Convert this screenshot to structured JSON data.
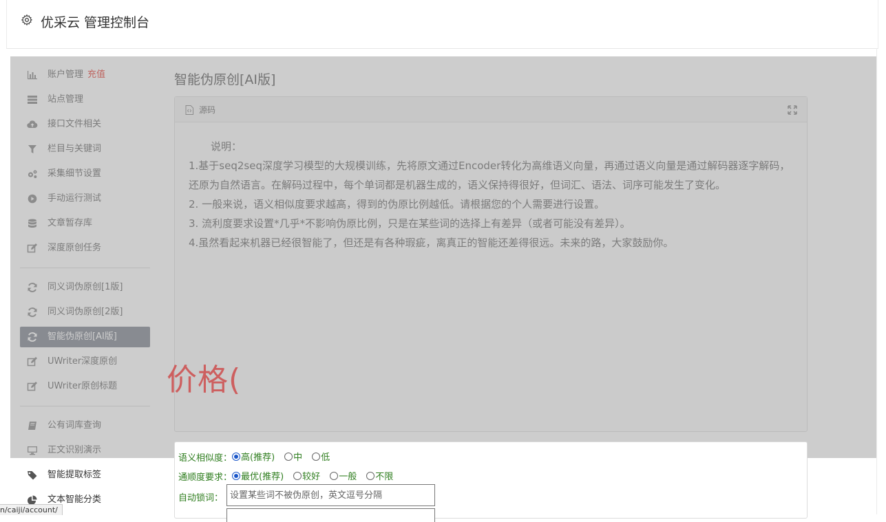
{
  "app": {
    "title": "优采云 管理控制台"
  },
  "sidebar": {
    "items": [
      {
        "label": "账户管理",
        "extra": "充值",
        "icon": "bar-chart-icon"
      },
      {
        "label": "站点管理",
        "icon": "server-icon"
      },
      {
        "label": "接口文件相关",
        "icon": "cloud-upload-icon"
      },
      {
        "label": "栏目与关键词",
        "icon": "filter-icon"
      },
      {
        "label": "采集细节设置",
        "icon": "gears-icon"
      },
      {
        "label": "手动运行测试",
        "icon": "play-circle-icon"
      },
      {
        "label": "文章暂存库",
        "icon": "database-icon"
      },
      {
        "label": "深度原创任务",
        "icon": "edit-icon"
      },
      {
        "label": "同义词伪原创[1版]",
        "icon": "refresh-icon"
      },
      {
        "label": "同义词伪原创[2版]",
        "icon": "refresh-icon"
      },
      {
        "label": "智能伪原创[AI版]",
        "icon": "refresh-icon",
        "active": true
      },
      {
        "label": "UWriter深度原创",
        "icon": "edit-icon"
      },
      {
        "label": "UWriter原创标题",
        "icon": "edit-icon"
      },
      {
        "label": "公有词库查询",
        "icon": "book-icon"
      },
      {
        "label": "正文识别演示",
        "icon": "monitor-icon"
      },
      {
        "label": "智能提取标签",
        "icon": "tag-icon"
      },
      {
        "label": "文本智能分类",
        "icon": "pie-chart-icon"
      }
    ]
  },
  "main": {
    "page_title": "智能伪原创[AI版]",
    "source_panel": {
      "header_label": "源码",
      "content": [
        "说明：",
        "1.基于seq2seq深度学习模型的大规模训练，先将原文通过Encoder转化为高维语义向量，再通过语义向量是通过解码器逐字解码，还原为自然语言。在解码过程中，每个单词都是机器生成的，语义保持得很好，但词汇、语法、词序可能发生了变化。",
        "2. 一般来说，语义相似度要求越高，得到的伪原比例越低。请根据您的个人需要进行设置。",
        "3. 流利度要求设置*几乎*不影响伪原比例，只是在某些词的选择上有差异（或者可能没有差异）。",
        "4.虽然看起来机器已经很智能了，但还是有各种瑕疵，离真正的智能还差得很远。未来的路，大家鼓励你。"
      ]
    },
    "overlay_text": "价格(",
    "options": {
      "similarity": {
        "label": "语义相似度：",
        "choices": [
          "高(推荐)",
          "中",
          "低"
        ],
        "selected": 0
      },
      "fluency": {
        "label": "通顺度要求：",
        "choices": [
          "最优(推荐)",
          "较好",
          "一般",
          "不限"
        ],
        "selected": 0
      },
      "autolock": {
        "label": "自动锁词：",
        "placeholder": "设置某些词不被伪原创，英文逗号分隔"
      }
    }
  },
  "statusbar": {
    "url": "n/caiji/account/"
  },
  "colors": {
    "accent_red": "#ff1b1b",
    "active_item_bg": "#6f7683",
    "option_text": "#2e7d1e"
  }
}
